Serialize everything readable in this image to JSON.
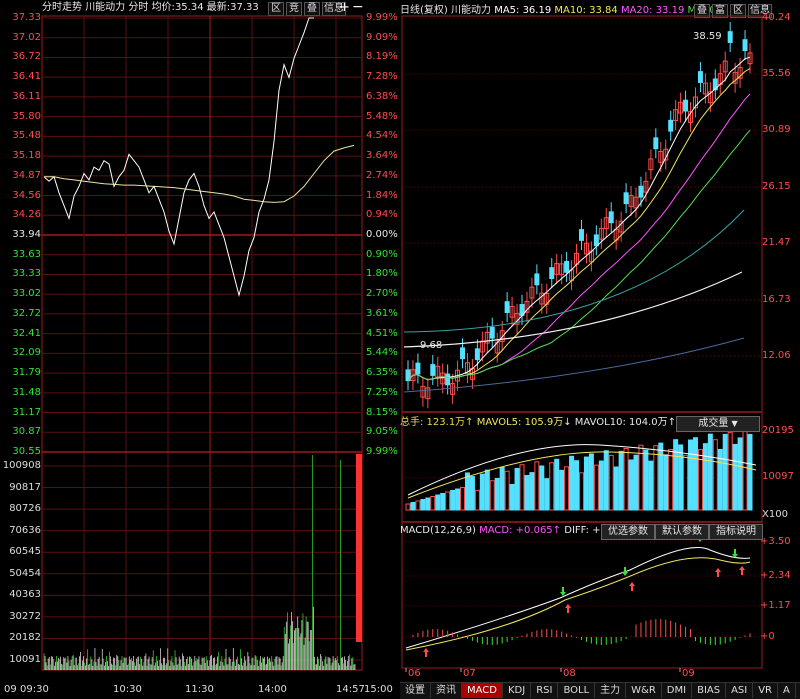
{
  "intraday": {
    "header": {
      "mode_label": "分时走势",
      "stock": "川能动力",
      "type": "分时",
      "avg_label": "均价:",
      "avg_value": "35.34",
      "latest_label": "最新:",
      "latest_value": "37.33"
    },
    "header_buttons": [
      "区",
      "竞",
      "叠",
      "信息"
    ],
    "price_ticks": [
      "37.33",
      "37.02",
      "36.72",
      "36.41",
      "36.11",
      "35.80",
      "35.48",
      "35.18",
      "34.87",
      "34.56",
      "34.26",
      "33.94",
      "33.63",
      "33.33",
      "33.02",
      "32.72",
      "32.41",
      "32.09",
      "31.79",
      "31.48",
      "31.17",
      "30.87",
      "30.55"
    ],
    "pct_ticks": [
      "9.99%",
      "9.09%",
      "8.19%",
      "7.28%",
      "6.38%",
      "5.48%",
      "4.54%",
      "3.64%",
      "2.74%",
      "1.84%",
      "0.94%",
      "0.00%",
      "0.90%",
      "1.80%",
      "2.70%",
      "3.61%",
      "4.51%",
      "5.44%",
      "6.35%",
      "7.25%",
      "8.15%",
      "9.05%",
      "9.99%"
    ],
    "ref_price_index": 11,
    "volume_ticks": [
      "100908",
      "90817",
      "80726",
      "70636",
      "60545",
      "50454",
      "40363",
      "30272",
      "20182",
      "10091"
    ],
    "time_ticks": [
      "09:30",
      "10:30",
      "11:30",
      "14:00",
      "14:57",
      "15:00"
    ],
    "time_axis_start": "09"
  },
  "daily": {
    "header": {
      "title": "日线(复权)",
      "stock": "川能动力",
      "ma5": "MA5: 36.19",
      "ma10": "MA10: 33.84",
      "ma20": "MA20: 33.19",
      "ma30": "MA30"
    },
    "header_buttons": [
      "叠",
      "富",
      "区",
      "信息"
    ],
    "price_ticks": [
      "40.24",
      "35.56",
      "30.89",
      "26.15",
      "21.47",
      "16.73",
      "12.06"
    ],
    "high_annotation": "38.59",
    "low_annotation": "9.68",
    "volume_header": {
      "total": "总手: 123.1万↑",
      "mavol5": "MAVOL5: 105.9万↓",
      "mavol10": "MAVOL10: 104.0万↑"
    },
    "volume_select": "成交量",
    "volume_ticks": [
      "20195",
      "10097",
      "X100"
    ],
    "macd_header": {
      "title": "MACD(12,26,9)",
      "macd": "MACD: +0.065↑",
      "diff": "DIFF: +2.74↑"
    },
    "macd_buttons": [
      "优选参数",
      "默认参数",
      "指标说明"
    ],
    "macd_ticks": [
      "3.50",
      "2.34",
      "1.17",
      "0"
    ],
    "month_ticks": [
      "06",
      "07",
      "08",
      "09"
    ]
  },
  "tabs": [
    "设置",
    "资讯",
    "MACD",
    "KDJ",
    "RSI",
    "BOLL",
    "主力",
    "W&R",
    "DMI",
    "BIAS",
    "ASI",
    "VR",
    "A"
  ],
  "active_tab": "MACD",
  "colors": {
    "up": "#ff4d4d",
    "down": "#34e334",
    "frame": "#9b1b1b",
    "grid": "#5a1010",
    "price_line": "#ffffff",
    "avg_line": "#e6e6a0",
    "candle_down": "#54e0ff",
    "ma5": "#ffffff",
    "ma10": "#f2e75a",
    "ma20": "#ff55ff",
    "ma30": "#54e054",
    "vol_up": "#ff4d4d",
    "vol_down": "#54e0ff"
  }
}
